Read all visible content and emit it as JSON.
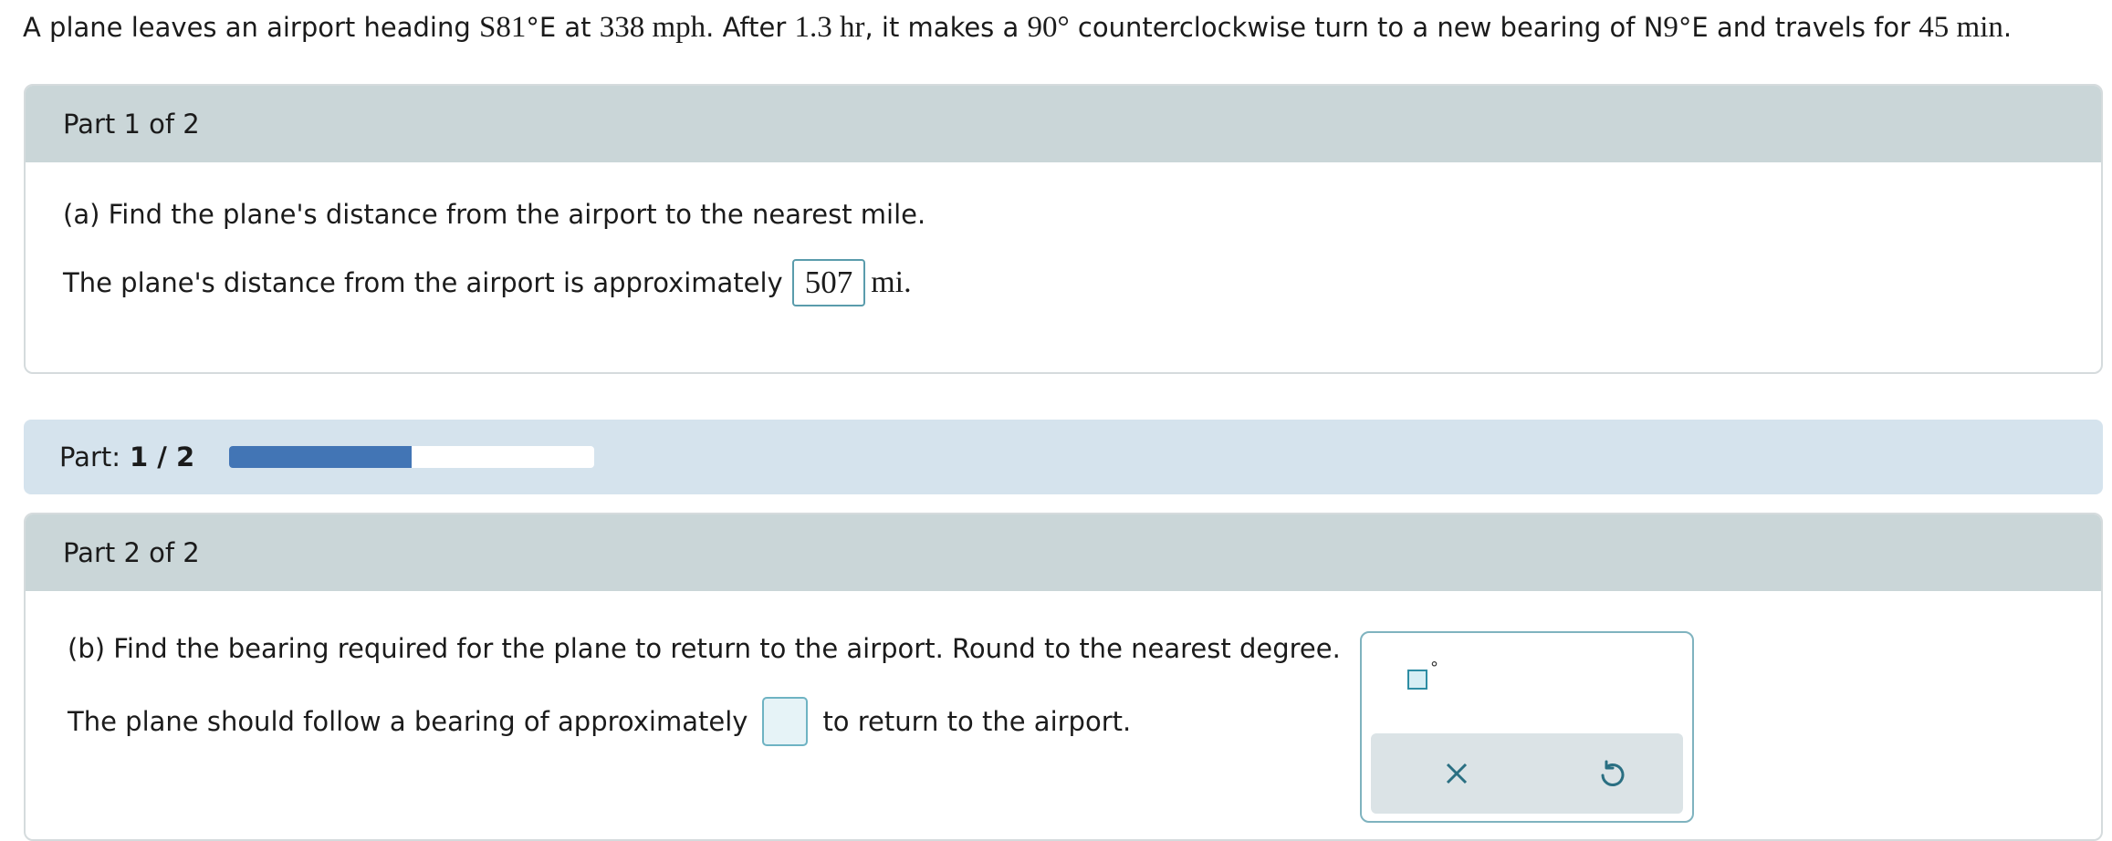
{
  "problem": {
    "t1": "A plane leaves an airport heading ",
    "m1": "S81",
    "t2": "°E at ",
    "m2": "338",
    "m3": " mph",
    "t3": ". After ",
    "m4": "1.3",
    "m5": " hr",
    "t4": ", it makes a ",
    "m6": "90°",
    "t5": " counterclockwise turn to a new bearing of N",
    "m7": "9",
    "t6": "°E and travels for ",
    "m8": "45",
    "m9": " min",
    "t7": "."
  },
  "part1": {
    "header": "Part 1 of 2",
    "question": "(a) Find the plane's distance from the airport to the nearest mile.",
    "answer_prefix": "The plane's distance from the airport is approximately",
    "answer_value": "507",
    "answer_unit": "mi."
  },
  "progress": {
    "label": "Part:",
    "value": "1 / 2",
    "fraction": 0.5,
    "fill_color": "#4275b5"
  },
  "part2": {
    "header": "Part 2 of 2",
    "question": "(b) Find the bearing required for the plane to return to the airport. Round to the nearest degree.",
    "answer_prefix": "The plane should follow a bearing of approximately",
    "answer_value": "",
    "answer_suffix": "to return to the airport."
  },
  "palette": {
    "degree_symbol": "°",
    "clear_icon": "close-icon",
    "undo_icon": "undo-icon"
  }
}
